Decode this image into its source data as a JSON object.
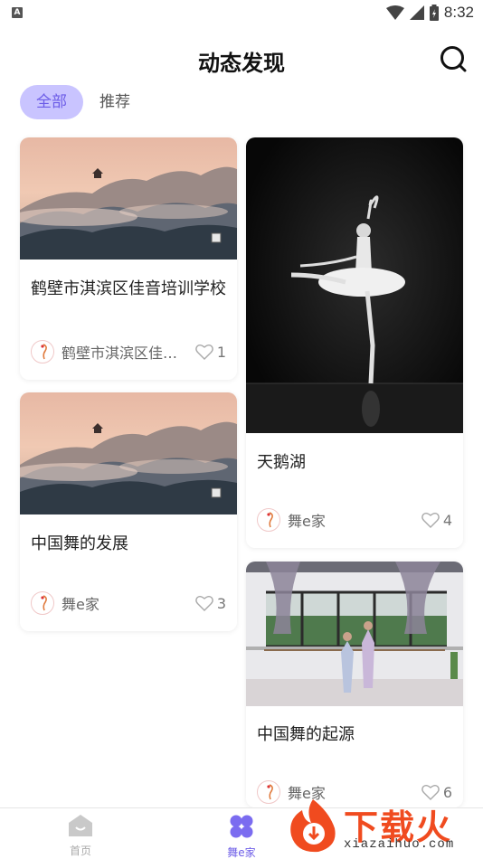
{
  "status_bar": {
    "time": "8:32",
    "notification_letter": "A"
  },
  "header": {
    "title": "动态发现"
  },
  "tabs": [
    {
      "label": "全部",
      "active": true
    },
    {
      "label": "推荐",
      "active": false
    }
  ],
  "cards": [
    {
      "title": "鹤壁市淇滨区佳音培训学校",
      "author": "鹤壁市淇滨区佳…",
      "likes": "1",
      "image": "landscape-mist"
    },
    {
      "title": "中国舞的发展",
      "author": "舞e家",
      "likes": "3",
      "image": "landscape-mist"
    },
    {
      "title": "天鹅湖",
      "author": "舞e家",
      "likes": "4",
      "image": "ballerina-bw"
    },
    {
      "title": "中国舞的起源",
      "author": "舞e家",
      "likes": "6",
      "image": "dance-studio"
    }
  ],
  "bottom_nav": [
    {
      "label": "首页",
      "icon": "home-icon",
      "active": false
    },
    {
      "label": "舞e家",
      "icon": "grid-icon",
      "active": true
    }
  ],
  "watermark": {
    "text": "下载火",
    "url": "xiazaihuo.com"
  },
  "colors": {
    "accent": "#6c5ce7",
    "tab_active_bg": "#c9c4ff",
    "watermark": "#f04b1f"
  }
}
